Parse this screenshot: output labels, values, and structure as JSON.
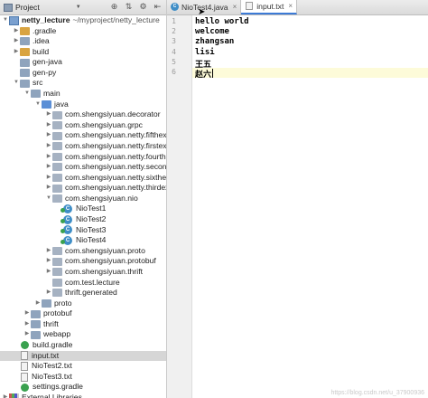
{
  "project_header": {
    "title": "Project"
  },
  "tree": [
    {
      "label": "netty_lecture",
      "suffix": "~/myproject/netty_lecture",
      "depth": 0,
      "arrow": "down",
      "icon": "module-icon",
      "bold": true
    },
    {
      "label": ".gradle",
      "depth": 1,
      "arrow": "right",
      "icon": "folder-orange-icon"
    },
    {
      "label": ".idea",
      "depth": 1,
      "arrow": "right",
      "icon": "folder-icon"
    },
    {
      "label": "build",
      "depth": 1,
      "arrow": "right",
      "icon": "folder-orange-icon"
    },
    {
      "label": "gen-java",
      "depth": 1,
      "arrow": "",
      "icon": "folder-icon"
    },
    {
      "label": "gen-py",
      "depth": 1,
      "arrow": "",
      "icon": "folder-icon"
    },
    {
      "label": "src",
      "depth": 1,
      "arrow": "down",
      "icon": "folder-icon"
    },
    {
      "label": "main",
      "depth": 2,
      "arrow": "down",
      "icon": "folder-icon"
    },
    {
      "label": "java",
      "depth": 3,
      "arrow": "down",
      "icon": "folder-blue-icon"
    },
    {
      "label": "com.shengsiyuan.decorator",
      "depth": 4,
      "arrow": "right",
      "icon": "package-icon"
    },
    {
      "label": "com.shengsiyuan.grpc",
      "depth": 4,
      "arrow": "right",
      "icon": "package-icon"
    },
    {
      "label": "com.shengsiyuan.netty.fifthexample",
      "depth": 4,
      "arrow": "right",
      "icon": "package-icon"
    },
    {
      "label": "com.shengsiyuan.netty.firstexample",
      "depth": 4,
      "arrow": "right",
      "icon": "package-icon"
    },
    {
      "label": "com.shengsiyuan.netty.fourthexample",
      "depth": 4,
      "arrow": "right",
      "icon": "package-icon"
    },
    {
      "label": "com.shengsiyuan.netty.secondexample",
      "depth": 4,
      "arrow": "right",
      "icon": "package-icon"
    },
    {
      "label": "com.shengsiyuan.netty.sixthexample",
      "depth": 4,
      "arrow": "right",
      "icon": "package-icon"
    },
    {
      "label": "com.shengsiyuan.netty.thirdexample",
      "depth": 4,
      "arrow": "right",
      "icon": "package-icon"
    },
    {
      "label": "com.shengsiyuan.nio",
      "depth": 4,
      "arrow": "down",
      "icon": "package-icon"
    },
    {
      "label": "NioTest1",
      "depth": 5,
      "arrow": "",
      "icon": "class-icon"
    },
    {
      "label": "NioTest2",
      "depth": 5,
      "arrow": "",
      "icon": "class-icon"
    },
    {
      "label": "NioTest3",
      "depth": 5,
      "arrow": "",
      "icon": "class-icon"
    },
    {
      "label": "NioTest4",
      "depth": 5,
      "arrow": "",
      "icon": "class-icon"
    },
    {
      "label": "com.shengsiyuan.proto",
      "depth": 4,
      "arrow": "right",
      "icon": "package-icon"
    },
    {
      "label": "com.shengsiyuan.protobuf",
      "depth": 4,
      "arrow": "right",
      "icon": "package-icon"
    },
    {
      "label": "com.shengsiyuan.thrift",
      "depth": 4,
      "arrow": "right",
      "icon": "package-icon"
    },
    {
      "label": "com.test.lecture",
      "depth": 4,
      "arrow": "",
      "icon": "package-icon"
    },
    {
      "label": "thrift.generated",
      "depth": 4,
      "arrow": "right",
      "icon": "package-icon"
    },
    {
      "label": "proto",
      "depth": 3,
      "arrow": "right",
      "icon": "folder-icon"
    },
    {
      "label": "protobuf",
      "depth": 2,
      "arrow": "right",
      "icon": "folder-icon"
    },
    {
      "label": "thrift",
      "depth": 2,
      "arrow": "right",
      "icon": "folder-icon"
    },
    {
      "label": "webapp",
      "depth": 2,
      "arrow": "right",
      "icon": "folder-icon"
    },
    {
      "label": "build.gradle",
      "depth": 1,
      "arrow": "",
      "icon": "gradle-icon"
    },
    {
      "label": "input.txt",
      "depth": 1,
      "arrow": "",
      "icon": "text-file-icon",
      "selected": true
    },
    {
      "label": "NioTest2.txt",
      "depth": 1,
      "arrow": "",
      "icon": "text-file-icon"
    },
    {
      "label": "NioTest3.txt",
      "depth": 1,
      "arrow": "",
      "icon": "text-file-icon"
    },
    {
      "label": "settings.gradle",
      "depth": 1,
      "arrow": "",
      "icon": "gradle-icon"
    },
    {
      "label": "External Libraries",
      "depth": 0,
      "arrow": "right",
      "icon": "libraries-icon"
    }
  ],
  "tabs": [
    {
      "label": "NioTest4.java",
      "icon": "class-icon",
      "active": false
    },
    {
      "label": "input.txt",
      "icon": "text-file-icon",
      "active": true
    }
  ],
  "editor": {
    "line_numbers": [
      "1",
      "2",
      "3",
      "4",
      "5",
      "6"
    ],
    "lines": [
      "hello world",
      "welcome",
      "zhangsan",
      "lisi",
      "王五",
      "赵六"
    ],
    "current_line": 6
  },
  "watermark": "https://blog.csdn.net/u_37900936"
}
